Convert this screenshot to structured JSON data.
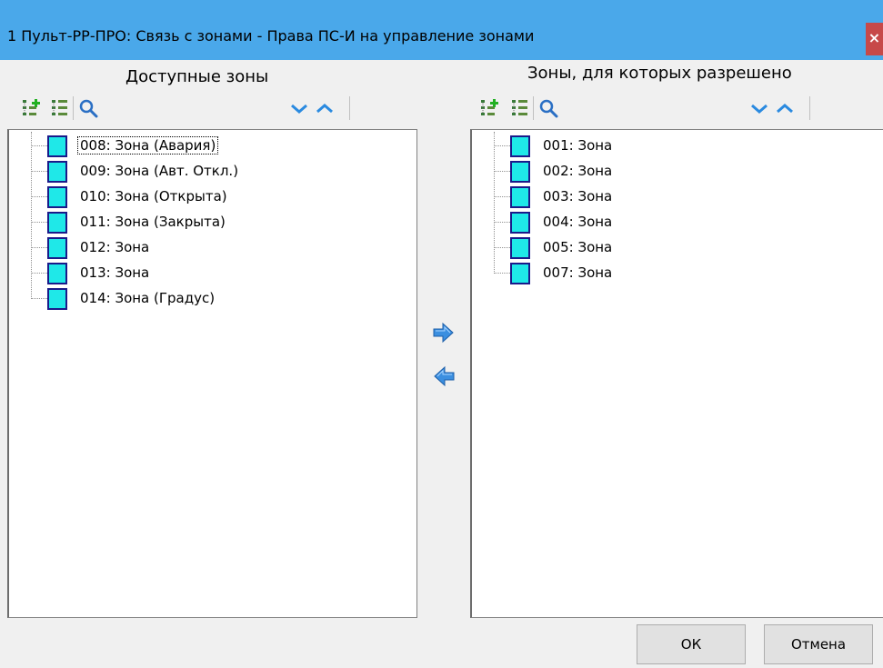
{
  "window": {
    "title": "1 Пульт-РР-ПРО: Связь с зонами - Права ПС-И на управление зонами",
    "close_glyph": "×"
  },
  "left_pane": {
    "caption": "Доступные зоны",
    "toolbar_icons": [
      "add-zone-icon",
      "tree-list-icon",
      "search-icon",
      "chevron-down-icon",
      "chevron-up-icon"
    ],
    "items": [
      {
        "label": "008: Зона (Авария)",
        "focused": true
      },
      {
        "label": "009: Зона (Авт. Откл.)"
      },
      {
        "label": "010: Зона (Открыта)"
      },
      {
        "label": "011: Зона (Закрыта)"
      },
      {
        "label": "012: Зона"
      },
      {
        "label": "013: Зона"
      },
      {
        "label": "014: Зона (Градус)"
      }
    ]
  },
  "right_pane": {
    "caption": "Зоны, для которых разрешено",
    "toolbar_icons": [
      "add-zone-icon",
      "tree-list-icon",
      "search-icon",
      "chevron-down-icon",
      "chevron-up-icon"
    ],
    "items": [
      {
        "label": "001: Зона"
      },
      {
        "label": "002: Зона"
      },
      {
        "label": "003: Зона"
      },
      {
        "label": "004: Зона"
      },
      {
        "label": "005: Зона"
      },
      {
        "label": "007: Зона"
      }
    ]
  },
  "transfer": {
    "move_right_icon": "arrow-right-icon",
    "move_left_icon": "arrow-left-icon"
  },
  "buttons": {
    "ok_label": "ОК",
    "cancel_label": "Отмена"
  },
  "colors": {
    "titlebar": "#4aa8ea",
    "zone_fill": "#1fe8e8",
    "zone_border": "#1a1a8a",
    "close": "#c74949"
  }
}
